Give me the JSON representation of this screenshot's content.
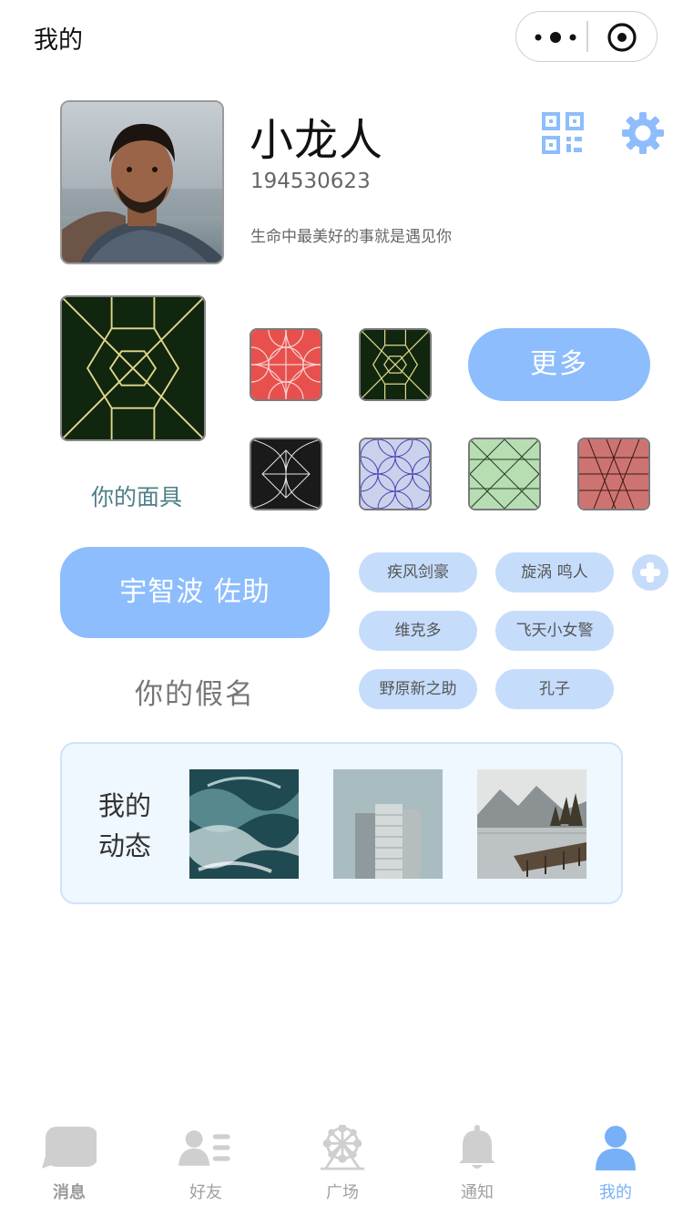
{
  "header": {
    "title": "我的"
  },
  "profile": {
    "nickname": "小龙人",
    "id": "194530623",
    "signature": "生命中最美好的事就是遇见你"
  },
  "masks": {
    "label": "你的面具",
    "more_label": "更多",
    "colors": {
      "accent": "#8dbdfd",
      "mask_label": "#4e7f86"
    }
  },
  "alias": {
    "current": "宇智波 佐助",
    "label": "你的假名",
    "options": [
      "疾风剑豪",
      "旋涡 鸣人",
      "维克多",
      "飞天小女警",
      "野原新之助",
      "孔子"
    ]
  },
  "moments": {
    "title": "我的动态"
  },
  "tabbar": {
    "items": [
      {
        "label": "消息",
        "icon": "message-icon"
      },
      {
        "label": "好友",
        "icon": "friends-icon"
      },
      {
        "label": "广场",
        "icon": "ferris-wheel-icon"
      },
      {
        "label": "通知",
        "icon": "bell-icon"
      },
      {
        "label": "我的",
        "icon": "person-icon"
      }
    ],
    "active": "我的",
    "colors": {
      "active": "#78b0f7",
      "inactive": "#c8c8c8"
    }
  }
}
